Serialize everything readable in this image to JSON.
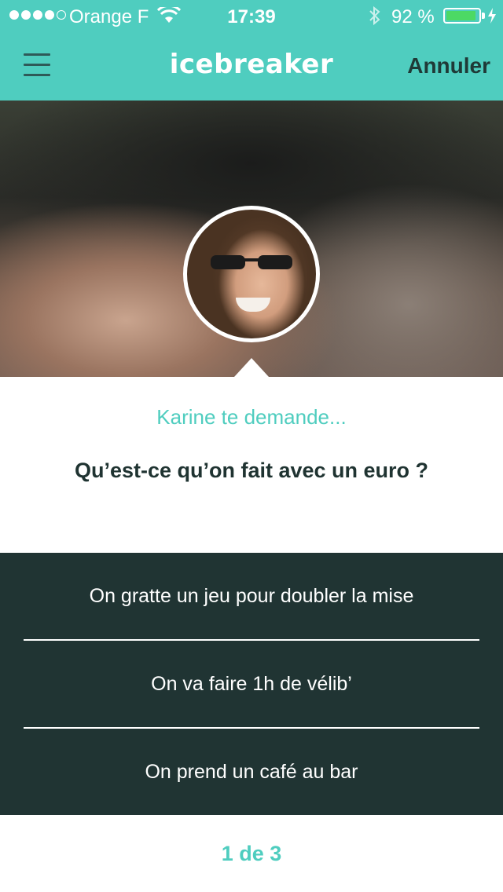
{
  "status_bar": {
    "carrier": "Orange F",
    "time": "17:39",
    "battery_percent": "92 %",
    "battery_level": 0.92,
    "signal_bars_filled": 4,
    "signal_bars_total": 5
  },
  "nav": {
    "title": "icebreaker",
    "cancel_label": "Annuler",
    "menu_icon": "hamburger-menu-icon"
  },
  "question": {
    "asker_text": "Karine te demande...",
    "text": "Qu’est-ce qu’on fait avec un euro ?"
  },
  "answers": [
    {
      "label": "On gratte un jeu pour doubler la mise"
    },
    {
      "label": "On va faire 1h de vélib’"
    },
    {
      "label": "On prend un café au bar"
    }
  ],
  "pager": {
    "label": "1 de 3"
  },
  "colors": {
    "accent": "#4fcdbf",
    "dark_panel": "#203433",
    "nav_text": "#1f3a37",
    "battery_fill": "#4cd964"
  }
}
